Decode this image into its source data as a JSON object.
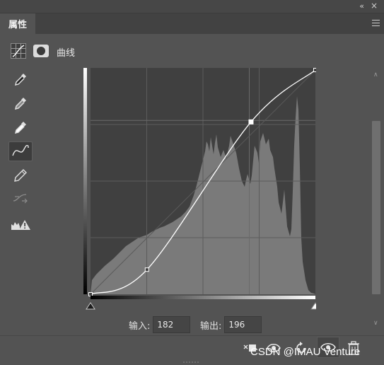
{
  "panel": {
    "tab_title": "属性",
    "collapse_glyph": "«",
    "close_glyph": "×",
    "menu_icon": "panel-menu-icon"
  },
  "header": {
    "title": "曲线",
    "icons": [
      "curves-adjustment-icon",
      "layer-mask-icon"
    ]
  },
  "tools": [
    {
      "name": "black-point-eyedropper-icon",
      "selected": false
    },
    {
      "name": "gray-point-eyedropper-icon",
      "selected": false
    },
    {
      "name": "white-point-eyedropper-icon",
      "selected": false
    },
    {
      "name": "edit-points-curve-icon",
      "selected": true
    },
    {
      "name": "draw-pencil-icon",
      "selected": false
    },
    {
      "name": "smooth-curve-icon",
      "selected": false
    },
    {
      "name": "clipping-warning-icon",
      "selected": false
    }
  ],
  "curve": {
    "points": [
      [
        0,
        0
      ],
      [
        64,
        28
      ],
      [
        182,
        196
      ],
      [
        255,
        255
      ]
    ],
    "selected_point": [
      182,
      196
    ],
    "accent": "#ffffff"
  },
  "io": {
    "input_label": "输入:",
    "input_value": "182",
    "output_label": "输出:",
    "output_value": "196"
  },
  "bottom_icons": [
    "clip-to-layer-icon",
    "view-previous-state-icon",
    "reset-icon",
    "visibility-eye-icon",
    "delete-trash-icon"
  ],
  "watermark": "CSDN @IMAU Venture"
}
